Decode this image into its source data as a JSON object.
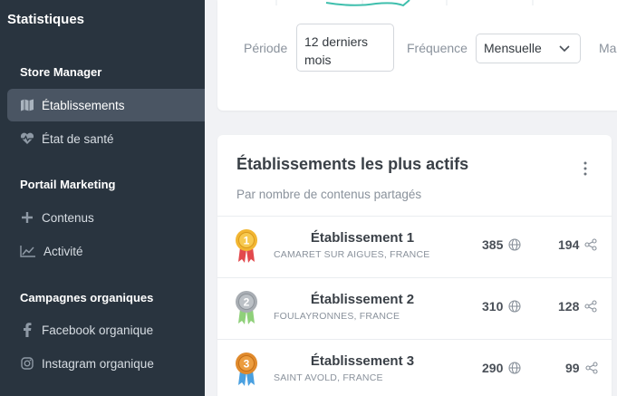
{
  "app": {
    "title": "Statistiques"
  },
  "sidebar": {
    "sections": [
      {
        "title": "Store Manager"
      },
      {
        "title": "Portail Marketing"
      },
      {
        "title": "Campagnes organiques"
      }
    ],
    "items": [
      {
        "label": "Établissements",
        "icon": "map-icon",
        "active": true
      },
      {
        "label": "État de santé",
        "icon": "heartbeat-icon"
      },
      {
        "label": "Contenus",
        "icon": "plus-icon"
      },
      {
        "label": "Activité",
        "icon": "chart-line-icon"
      },
      {
        "label": "Facebook organique",
        "icon": "facebook-icon"
      },
      {
        "label": "Instagram organique",
        "icon": "instagram-icon"
      }
    ]
  },
  "filters": {
    "period_label": "Période",
    "period_value": "12 derniers mois",
    "frequency_label": "Fréquence",
    "frequency_value": "Mensuelle",
    "third_label_partial": "Ma"
  },
  "top_card": {
    "title": "Établissements les plus actifs",
    "subtitle": "Par nombre de contenus partagés",
    "rows": [
      {
        "rank": "1",
        "medal": "gold",
        "name": "Établissement 1",
        "location": "CAMARET SUR AIGUES, FRANCE",
        "contents": "385",
        "shares": "194"
      },
      {
        "rank": "2",
        "medal": "silver",
        "name": "Établissement 2",
        "location": "FOULAYRONNES, FRANCE",
        "contents": "310",
        "shares": "128"
      },
      {
        "rank": "3",
        "medal": "bronze",
        "name": "Établissement 3",
        "location": "SAINT AVOLD, FRANCE",
        "contents": "290",
        "shares": "99"
      }
    ]
  },
  "colors": {
    "sidebar_bg": "#29343f",
    "active_item_bg": "#4a5563",
    "gold": "#f2b632",
    "silver": "#a8adb3",
    "bronze": "#e08a2c",
    "ribbon_red": "#e2494d",
    "ribbon_green": "#8fd07a",
    "ribbon_blue": "#4aa0e0"
  }
}
